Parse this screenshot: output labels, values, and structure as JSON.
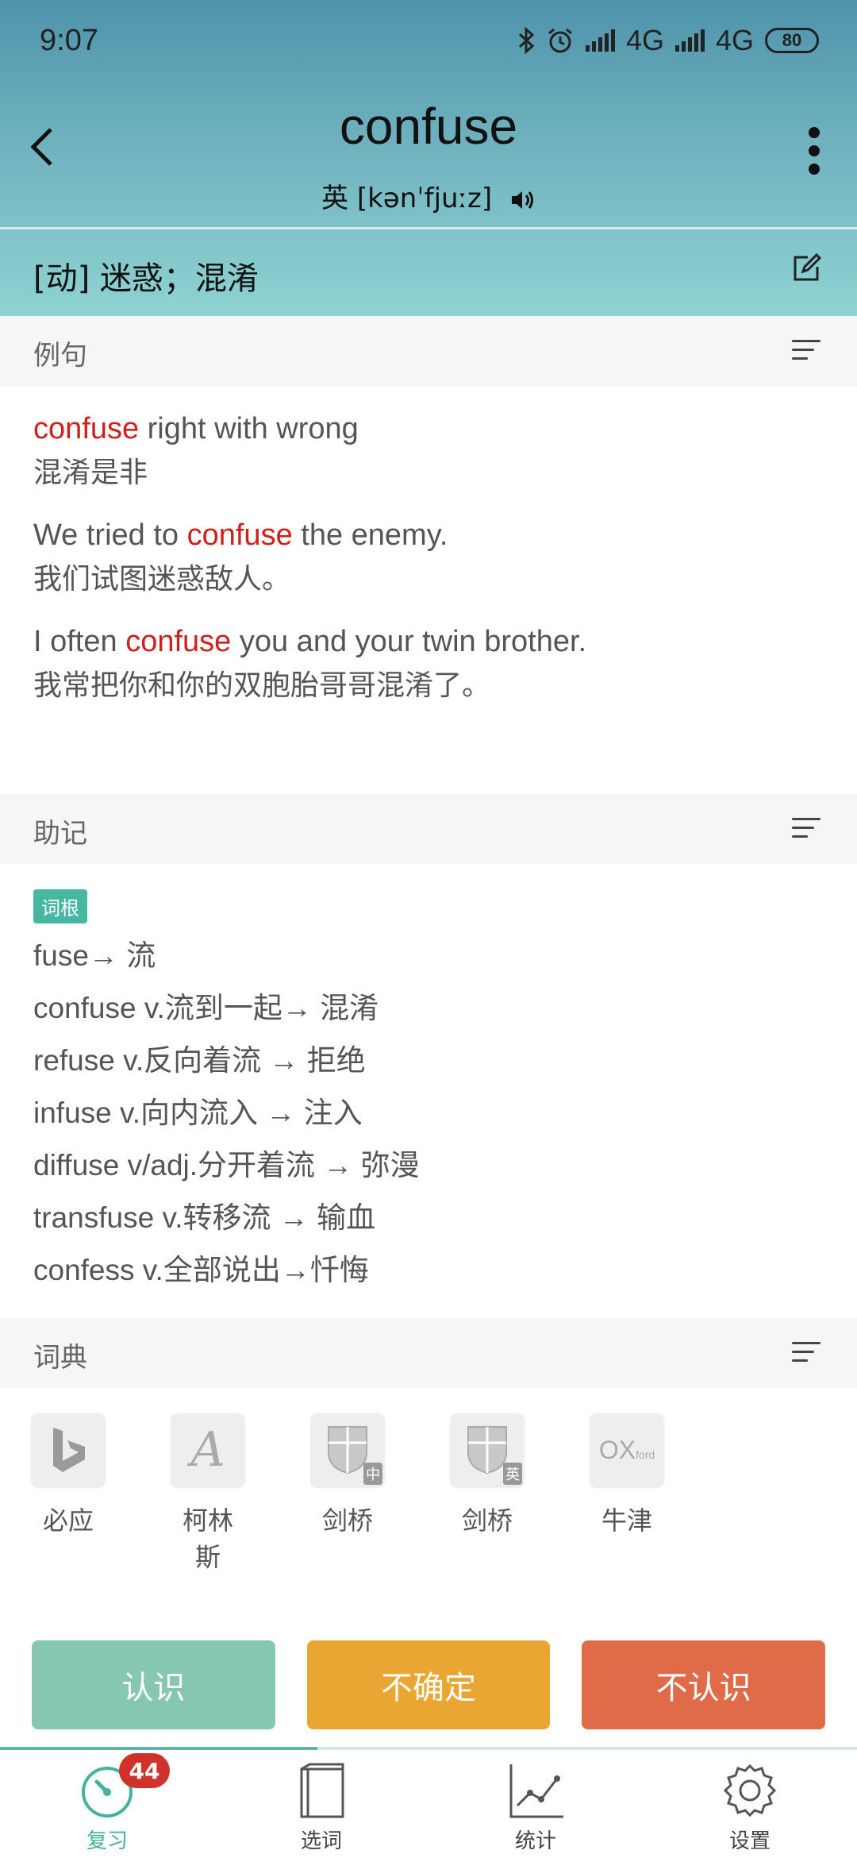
{
  "status": {
    "time": "9:07",
    "network1": "4G",
    "network2": "4G",
    "battery": "80"
  },
  "word": {
    "text": "confuse",
    "phonetic_label": "英",
    "phonetic": "[kənˈfjuːz]"
  },
  "meaning": "[动] 迷惑；混淆",
  "sections": {
    "examples_title": "例句",
    "mnemonic_title": "助记",
    "dict_title": "词典"
  },
  "examples": [
    {
      "pre": "",
      "hl": "confuse",
      "post": " right with wrong",
      "zh": "混淆是非"
    },
    {
      "pre": "We tried to ",
      "hl": "confuse",
      "post": " the enemy.",
      "zh": "我们试图迷惑敌人。"
    },
    {
      "pre": "I often ",
      "hl": "confuse",
      "post": " you and your twin brother.",
      "zh": "我常把你和你的双胞胎哥哥混淆了。"
    }
  ],
  "mnemonic": {
    "tag": "词根",
    "lines": [
      "fuse→ 流",
      "confuse v.流到一起→ 混淆",
      "refuse v.反向着流 → 拒绝",
      "infuse v.向内流入 → 注入",
      "diffuse v/adj.分开着流 → 弥漫",
      "transfuse v.转移流 → 输血",
      "confess v.全部说出→忏悔"
    ]
  },
  "dictionaries": [
    {
      "label": "必应",
      "icon": "bing-icon"
    },
    {
      "label": "柯林斯",
      "icon": "collins-icon"
    },
    {
      "label": "剑桥",
      "icon": "cambridge-icon",
      "badge": "中"
    },
    {
      "label": "剑桥",
      "icon": "cambridge-icon",
      "badge": "英"
    },
    {
      "label": "牛津",
      "icon": "oxford-icon",
      "logo": "OX",
      "logo_small": "ford"
    }
  ],
  "actions": {
    "know": "认识",
    "unsure": "不确定",
    "dont_know": "不认识"
  },
  "progress": 0.37,
  "tabs": [
    {
      "label": "复习",
      "active": true,
      "badge": "44"
    },
    {
      "label": "选词"
    },
    {
      "label": "统计"
    },
    {
      "label": "设置"
    }
  ],
  "colors": {
    "accent": "#44b39e",
    "highlight": "#d0201c",
    "know": "#86c7b2",
    "unsure": "#eaa633",
    "dont_know": "#e06b49"
  }
}
